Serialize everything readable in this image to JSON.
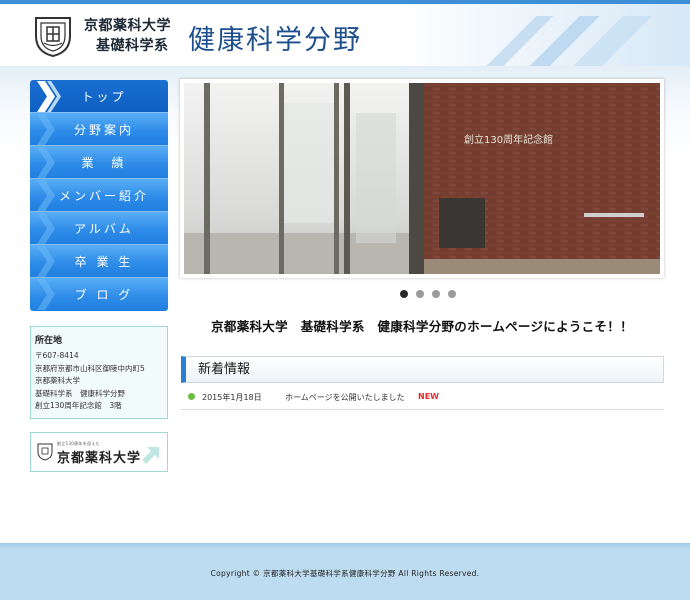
{
  "header": {
    "university_name": "京都薬科大学",
    "department": "基礎科学系",
    "site_title": "健康科学分野",
    "brand_color": "#1c4f8c"
  },
  "nav": {
    "items": [
      {
        "label": "トップ",
        "active": true
      },
      {
        "label": "分野案内",
        "active": false
      },
      {
        "label": "業　績",
        "active": false
      },
      {
        "label": "メンバー紹介",
        "active": false
      },
      {
        "label": "アルバム",
        "active": false
      },
      {
        "label": "卒 業 生",
        "active": false
      },
      {
        "label": "ブ ロ グ",
        "active": false
      }
    ],
    "accent_color": "#2f8ce8"
  },
  "address": {
    "title": "所在地",
    "lines": [
      "〒607-8414",
      "京都府京都市山科区御陵中内町5",
      "京都薬科大学",
      "基礎科学系　健康科学分野",
      "創立130周年記念館　3階"
    ]
  },
  "banner": {
    "small_text": "創立130周年を迎えた",
    "label": "京都薬科大学"
  },
  "slider": {
    "sign_text": "創立130周年記念館",
    "slide_count": 4,
    "active_slide": 1
  },
  "welcome_text": "京都薬科大学　基礎科学系　健康科学分野のホームページにようこそ！！",
  "news": {
    "heading": "新着情報",
    "items": [
      {
        "date": "2015年1月18日",
        "text": "ホームページを公開いたしました",
        "badge": "NEW"
      }
    ],
    "badge_color": "#e52b2b"
  },
  "footer": {
    "copyright": "Copyright © 京都薬科大学基礎科学系健康科学分野 All Rights Reserved."
  }
}
